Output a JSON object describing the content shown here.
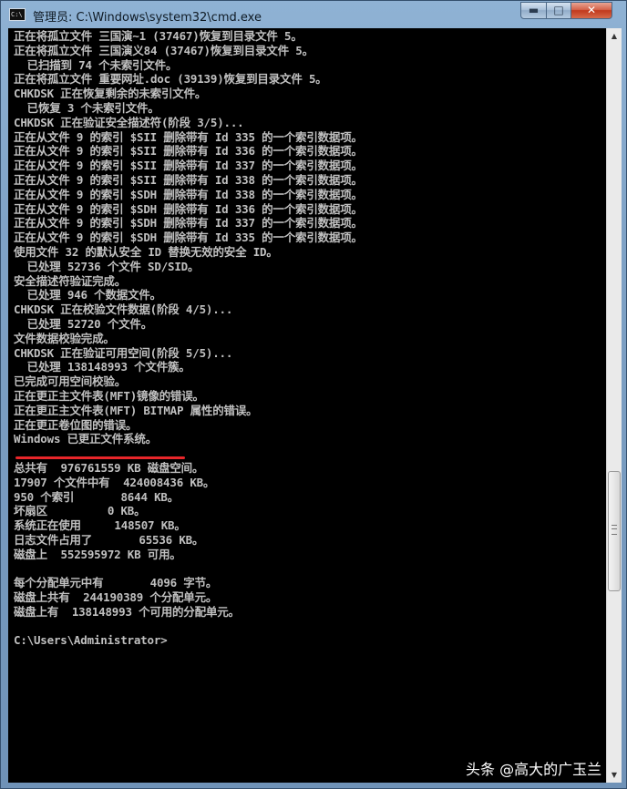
{
  "window": {
    "title": "管理员: C:\\Windows\\system32\\cmd.exe",
    "icon": "cmd-icon",
    "icon_label": "C:\\",
    "minimize_glyph": "▬",
    "maximize_glyph": "□",
    "close_glyph": "✕"
  },
  "console": {
    "lines": [
      "正在将孤立文件 三国演~1 (37467)恢复到目录文件 5。",
      "正在将孤立文件 三国演义84 (37467)恢复到目录文件 5。",
      "  已扫描到 74 个未索引文件。",
      "正在将孤立文件 重要网址.doc (39139)恢复到目录文件 5。",
      "CHKDSK 正在恢复剩余的未索引文件。",
      "  已恢复 3 个未索引文件。",
      "CHKDSK 正在验证安全描述符(阶段 3/5)...",
      "正在从文件 9 的索引 $SII 删除带有 Id 335 的一个索引数据项。",
      "正在从文件 9 的索引 $SII 删除带有 Id 336 的一个索引数据项。",
      "正在从文件 9 的索引 $SII 删除带有 Id 337 的一个索引数据项。",
      "正在从文件 9 的索引 $SII 删除带有 Id 338 的一个索引数据项。",
      "正在从文件 9 的索引 $SDH 删除带有 Id 338 的一个索引数据项。",
      "正在从文件 9 的索引 $SDH 删除带有 Id 336 的一个索引数据项。",
      "正在从文件 9 的索引 $SDH 删除带有 Id 337 的一个索引数据项。",
      "正在从文件 9 的索引 $SDH 删除带有 Id 335 的一个索引数据项。",
      "使用文件 32 的默认安全 ID 替换无效的安全 ID。",
      "  已处理 52736 个文件 SD/SID。",
      "安全描述符验证完成。",
      "  已处理 946 个数据文件。",
      "CHKDSK 正在校验文件数据(阶段 4/5)...",
      "  已处理 52720 个文件。",
      "文件数据校验完成。",
      "CHKDSK 正在验证可用空间(阶段 5/5)...",
      "  已处理 138148993 个文件簇。",
      "已完成可用空间校验。",
      "正在更正主文件表(MFT)镜像的错误。",
      "正在更正主文件表(MFT) BITMAP 属性的错误。",
      "正在更正卷位图的错误。",
      "Windows 已更正文件系统。",
      "",
      "总共有  976761559 KB 磁盘空间。",
      "17907 个文件中有  424008436 KB。",
      "950 个索引       8644 KB。",
      "坏扇区         0 KB。",
      "系统正在使用     148507 KB。",
      "日志文件占用了       65536 KB。",
      "磁盘上  552595972 KB 可用。",
      "",
      "每个分配单元中有       4096 字节。",
      "磁盘上共有  244190389 个分配单元。",
      "磁盘上有  138148993 个可用的分配单元。",
      "",
      "C:\\Users\\Administrator>"
    ]
  },
  "scrollbar": {
    "up_glyph": "▲",
    "down_glyph": "▼"
  },
  "watermark": "头条 @高大的广玉兰",
  "colors": {
    "console_bg": "#000000",
    "console_text": "#c0c0c0",
    "annotation_underline": "#e8262a"
  }
}
